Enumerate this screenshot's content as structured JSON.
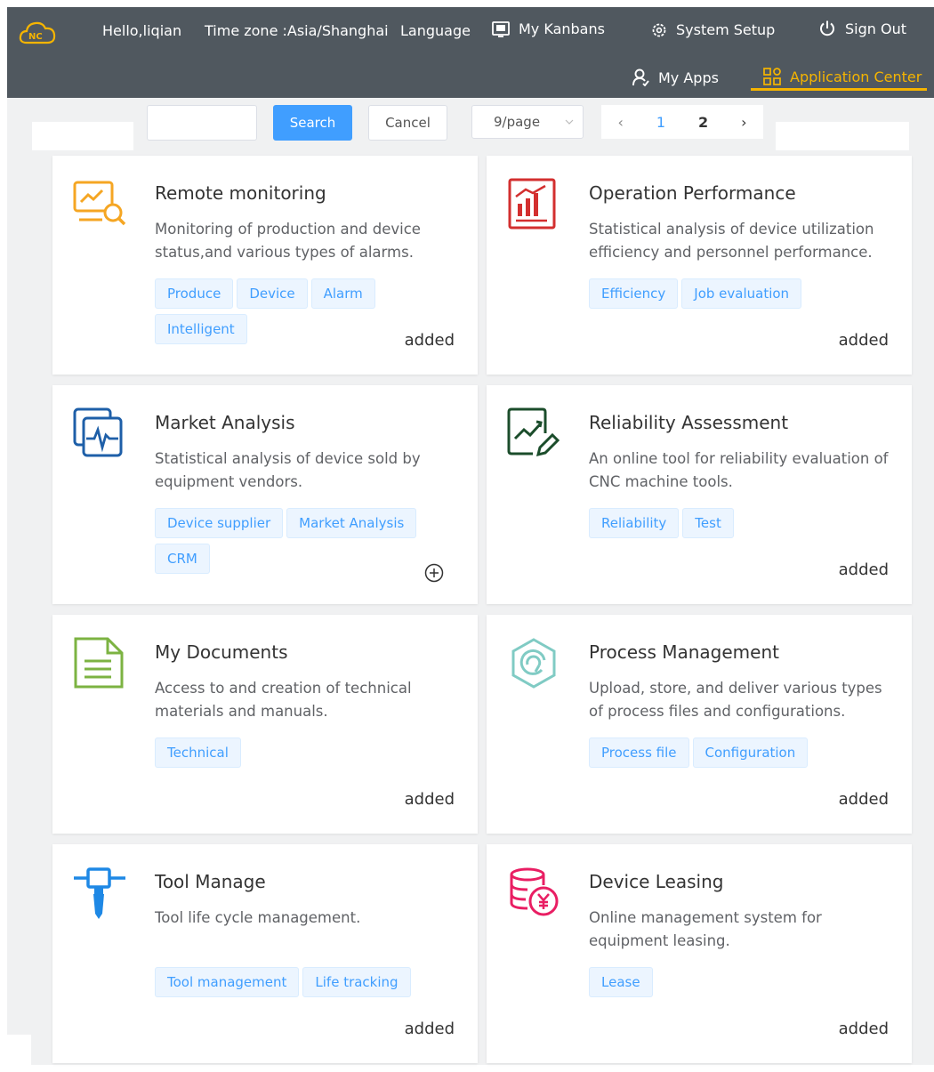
{
  "header": {
    "greeting": "Hello,liqian",
    "timezone": "Time zone :Asia/Shanghai",
    "language": "Language",
    "kanbans": "My Kanbans",
    "setup": "System Setup",
    "signout": "Sign Out",
    "myapps": "My Apps",
    "appcenter": "Application Center"
  },
  "toolbar": {
    "search_value": "",
    "search_label": "Search",
    "cancel_label": "Cancel",
    "page_size": "9/page",
    "pages": [
      "1",
      "2"
    ],
    "current_page": "1"
  },
  "colors": {
    "header_bg": "#50585f",
    "accent": "#409eff",
    "active_tab": "#f5b400"
  },
  "cards": [
    {
      "title": "Remote monitoring",
      "desc": "Monitoring of production and device status,and various types of alarms.",
      "tags": [
        "Produce",
        "Device",
        "Alarm",
        "Intelligent"
      ],
      "status": "added",
      "icon": "monitor-search-icon"
    },
    {
      "title": "Operation Performance",
      "desc": "Statistical analysis of device utilization efficiency and personnel performance.",
      "tags": [
        "Efficiency",
        "Job evaluation"
      ],
      "status": "added",
      "icon": "bar-chart-icon"
    },
    {
      "title": "Market Analysis",
      "desc": "Statistical analysis of device sold by equipment vendors.",
      "tags": [
        "Device supplier",
        "Market Analysis",
        "CRM"
      ],
      "status": "",
      "icon": "pulse-chart-icon"
    },
    {
      "title": "Reliability Assessment",
      "desc": "An online tool for reliability evaluation of CNC machine tools.",
      "tags": [
        "Reliability",
        "Test"
      ],
      "status": "added",
      "icon": "chart-edit-icon"
    },
    {
      "title": "My Documents",
      "desc": "Access to and creation of technical materials and manuals.",
      "tags": [
        "Technical"
      ],
      "status": "added",
      "icon": "document-icon"
    },
    {
      "title": "Process Management",
      "desc": "Upload, store, and deliver various types of process files and configurations.",
      "tags": [
        "Process file",
        "Configuration"
      ],
      "status": "added",
      "icon": "process-hexagon-icon"
    },
    {
      "title": "Tool Manage",
      "desc": "Tool life cycle management.",
      "tags": [
        "Tool management",
        "Life tracking"
      ],
      "status": "added",
      "icon": "tool-icon"
    },
    {
      "title": "Device Leasing",
      "desc": "Online management system for equipment leasing.",
      "tags": [
        "Lease"
      ],
      "status": "added",
      "icon": "coins-yen-icon"
    }
  ]
}
